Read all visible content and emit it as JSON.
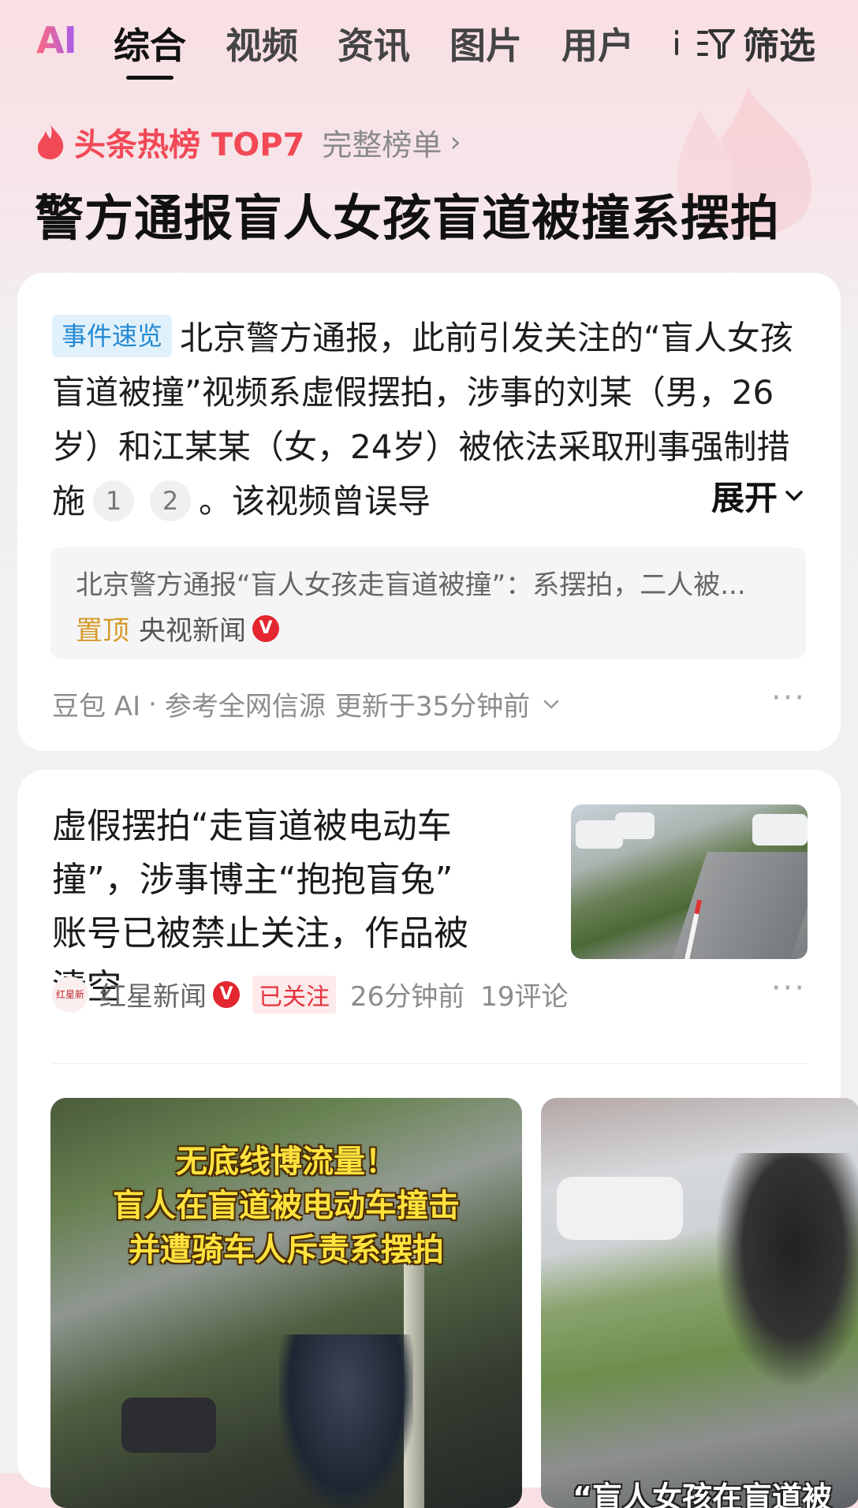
{
  "nav": {
    "ai_logo": "AI",
    "tabs": [
      {
        "label": "综合"
      },
      {
        "label": "视频"
      },
      {
        "label": "资讯"
      },
      {
        "label": "图片"
      },
      {
        "label": "用户"
      }
    ],
    "filter_label": "筛选"
  },
  "hot_list": {
    "title": "头条热榜 TOP7",
    "full_list_label": "完整榜单",
    "chevron": "›",
    "headline": "警方通报盲人女孩盲道被撞系摆拍"
  },
  "ai_summary": {
    "badge": "事件速览",
    "text_main": "北京警方通报，此前引发关注的“盲人女孩盲道被撞”视频系虚假摆拍，涉事的刘某（男，26岁）和江某某（女，24岁）被依法采取刑事强制措施",
    "citations": [
      "1",
      "2"
    ],
    "text_tail": "。该视频曾误导",
    "expand_label": "展开",
    "reference": {
      "title": "北京警方通报“盲人女孩走盲道被撞”：系摆拍，二人被...",
      "pin_label": "置顶",
      "source": "央视新闻",
      "verified": "V"
    },
    "footer": {
      "provider": "豆包 AI",
      "separator": "·",
      "scope": "参考全网信源",
      "updated": "更新于35分钟前"
    },
    "more": "···"
  },
  "news_item": {
    "title": "虚假摆拍“走盲道被电动车撞”，涉事博主“抱抱盲兔” 账号已被禁止关注，作品被清空",
    "source_logo_text": "红星新闻",
    "source": "红星新闻",
    "verified": "V",
    "followed_label": "已关注",
    "time": "26分钟前",
    "comments": "19评论",
    "more": "···"
  },
  "videos": [
    {
      "caption_lines": [
        "无底线博流量！",
        "盲人在盲道被电动车撞击",
        "并遭骑车人斥责系摆拍"
      ]
    },
    {
      "caption": "“盲人女孩在盲道被"
    }
  ],
  "colors": {
    "accent_red": "#f24957",
    "badge_blue": "#2389d4",
    "pin_gold": "#d79a2a",
    "followed_red": "#e5333d",
    "caption_yellow": "#ffe23d"
  }
}
